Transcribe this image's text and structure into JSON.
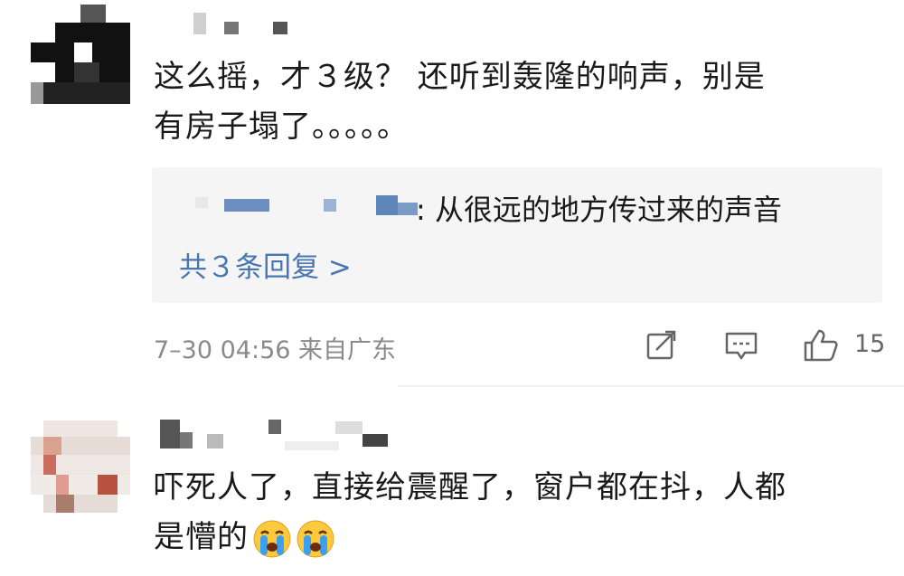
{
  "comments": [
    {
      "text_line1": "这么摇，才３级？ 还听到轰隆的响声，别是",
      "text_line2": "有房子塌了。。。。。",
      "reply": {
        "text": ": 从很远的地方传过来的声音",
        "more_label": "共３条回复 >"
      },
      "meta": "7–30 04:56 来自广东",
      "actions": {
        "share_icon": "share-icon",
        "comment_icon": "comment-icon",
        "like_icon": "thumb-up-icon",
        "likes": "15"
      }
    },
    {
      "text_line1": "吓死人了，直接给震醒了，窗户都在抖，人都",
      "text_line2": "是懵的",
      "emojis": [
        "crying-emoji",
        "crying-emoji"
      ]
    }
  ],
  "colors": {
    "link": "#4a76b0",
    "meta": "#8a8a8a",
    "reply_bg": "#f5f5f5"
  }
}
